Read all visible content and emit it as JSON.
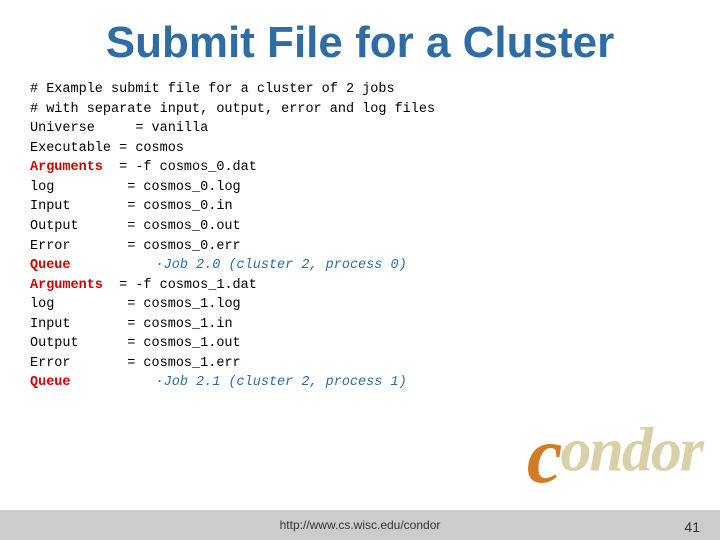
{
  "slide": {
    "title": "Submit File for a Cluster",
    "footer_url": "http://www.cs.wisc.edu/condor",
    "page_number": "41"
  },
  "code": {
    "comment1": "# Example submit file for a cluster of 2 jobs",
    "comment2": "# with separate input, output, error and log files",
    "lines": [
      {
        "key": "Universe",
        "sep": "  = ",
        "val": "vanilla"
      },
      {
        "key": "Executable",
        "sep": " = ",
        "val": "cosmos"
      },
      {
        "key": "Arguments",
        "sep": "  = ",
        "val": "-f cosmos_0.dat",
        "key_bold": true
      },
      {
        "key": "log",
        "sep": "        = ",
        "val": "cosmos_0.log"
      },
      {
        "key": "Input",
        "sep": "      = ",
        "val": "cosmos_0.in"
      },
      {
        "key": "Output",
        "sep": "     = ",
        "val": "cosmos_0.out"
      },
      {
        "key": "Error",
        "sep": "      = ",
        "val": "cosmos_0.err"
      }
    ],
    "queue1": "Job 2.0 (cluster 2, process 0)",
    "lines2": [
      {
        "key": "Arguments",
        "sep": "  = ",
        "val": "-f cosmos_1.dat",
        "key_bold": true
      },
      {
        "key": "log",
        "sep": "        = ",
        "val": "cosmos_1.log"
      },
      {
        "key": "Input",
        "sep": "      = ",
        "val": "cosmos_1.in"
      },
      {
        "key": "Output",
        "sep": "     = ",
        "val": "cosmos_1.out"
      },
      {
        "key": "Error",
        "sep": "      = ",
        "val": "cosmos_1.err"
      }
    ],
    "queue2": "Job 2.1 (cluster 2, process 1)"
  }
}
